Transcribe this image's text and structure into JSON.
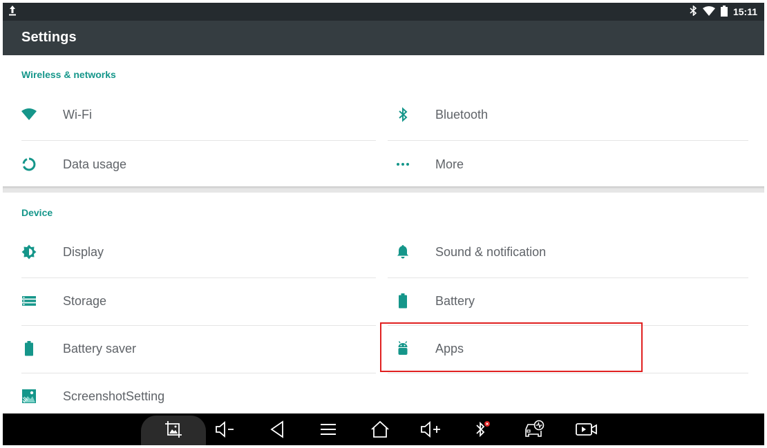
{
  "status_bar": {
    "time": "15:11",
    "icons": [
      "upload-icon",
      "bluetooth-icon",
      "wifi-icon",
      "battery-icon"
    ]
  },
  "action_bar": {
    "title": "Settings"
  },
  "sections": [
    {
      "header": "Wireless & networks",
      "items": [
        {
          "label": "Wi-Fi",
          "icon": "wifi-icon"
        },
        {
          "label": "Bluetooth",
          "icon": "bluetooth-icon"
        },
        {
          "label": "Data usage",
          "icon": "data-usage-icon"
        },
        {
          "label": "More",
          "icon": "more-icon"
        }
      ]
    },
    {
      "header": "Device",
      "items": [
        {
          "label": "Display",
          "icon": "brightness-icon"
        },
        {
          "label": "Sound & notification",
          "icon": "bell-icon"
        },
        {
          "label": "Storage",
          "icon": "storage-icon"
        },
        {
          "label": "Battery",
          "icon": "battery-icon"
        },
        {
          "label": "Battery saver",
          "icon": "battery-saver-icon"
        },
        {
          "label": "Apps",
          "icon": "android-icon"
        },
        {
          "label": "ScreenshotSetting",
          "icon": "screenshot-setting-icon"
        }
      ]
    }
  ],
  "colors": {
    "accent": "#15968a",
    "status_bar": "#252b2f",
    "action_bar": "#353d41",
    "highlight": "#e02020",
    "nav_bar": "#000000"
  },
  "nav_bar": {
    "buttons": [
      "screenshot-icon",
      "volume-down-icon",
      "back-icon",
      "menu-icon",
      "home-icon",
      "volume-up-icon",
      "bluetooth-alert-icon",
      "car-diagnostic-icon",
      "screen-record-icon"
    ]
  }
}
